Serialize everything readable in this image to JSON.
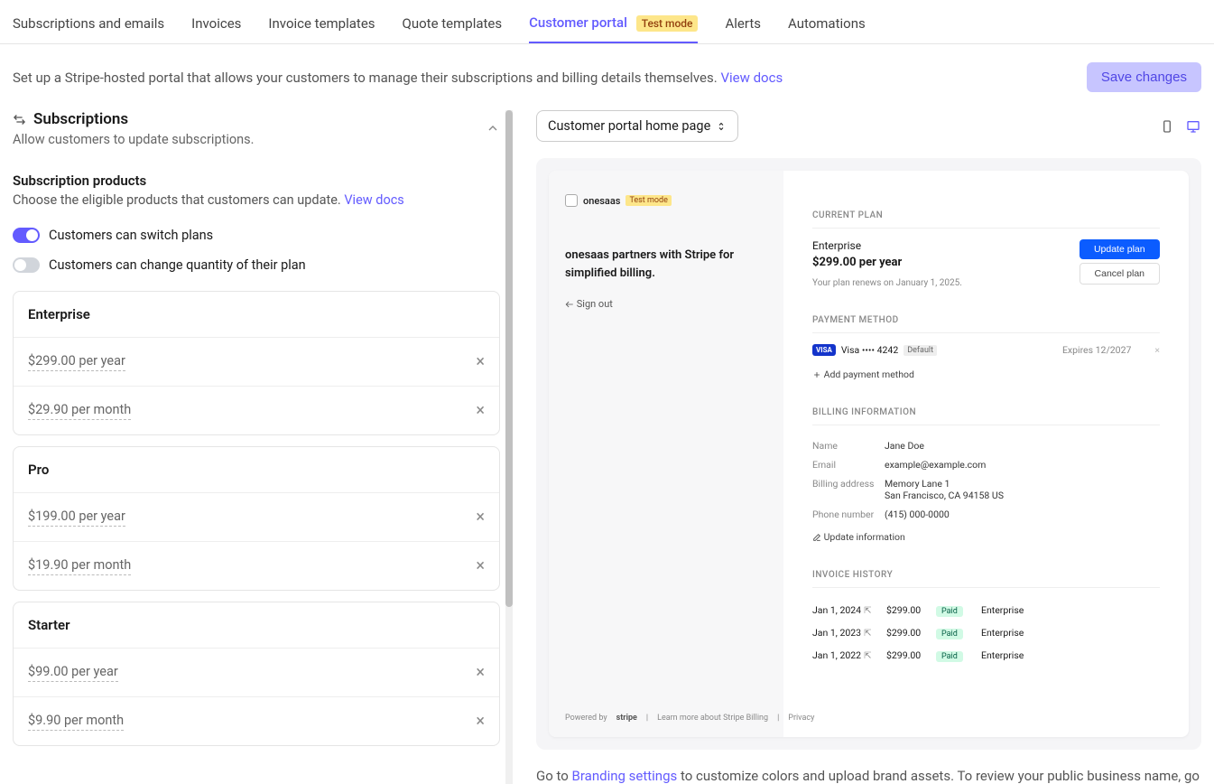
{
  "tabs": {
    "t0": "Subscriptions and emails",
    "t1": "Invoices",
    "t2": "Invoice templates",
    "t3": "Quote templates",
    "t4": "Customer portal",
    "badge": "Test mode",
    "t5": "Alerts",
    "t6": "Automations"
  },
  "desc": {
    "text": "Set up a Stripe-hosted portal that allows your customers to manage their subscriptions and billing details themselves.",
    "link": "View docs"
  },
  "save_btn": "Save changes",
  "section": {
    "title": "Subscriptions",
    "sub": "Allow customers to update subscriptions."
  },
  "subp": {
    "title": "Subscription products",
    "desc": "Choose the eligible products that customers can update.",
    "link": "View docs"
  },
  "toggles": {
    "switch": "Customers can switch plans",
    "qty": "Customers can change quantity of their plan"
  },
  "products": [
    {
      "name": "Enterprise",
      "prices": [
        "$299.00 per year",
        "$29.90 per month"
      ]
    },
    {
      "name": "Pro",
      "prices": [
        "$199.00 per year",
        "$19.90 per month"
      ]
    },
    {
      "name": "Starter",
      "prices": [
        "$99.00 per year",
        "$9.90 per month"
      ]
    }
  ],
  "preview": {
    "selector": "Customer portal home page"
  },
  "portal": {
    "logo": "onesaas",
    "tm": "Test mode",
    "tagline": "onesaas partners with Stripe for simplified billing.",
    "signout": "Sign out",
    "powered": "Powered by",
    "stripe": "stripe",
    "learn": "Learn more about Stripe Billing",
    "priv": "Privacy",
    "s_current": "CURRENT PLAN",
    "plan_name": "Enterprise",
    "plan_price": "$299.00 per year",
    "renew": "Your plan renews on January 1, 2025.",
    "btn_update": "Update plan",
    "btn_cancel": "Cancel plan",
    "s_pm": "PAYMENT METHOD",
    "card": "Visa •••• 4242",
    "def": "Default",
    "exp": "Expires 12/2027",
    "add_pm": "Add payment method",
    "s_bi": "BILLING INFORMATION",
    "bi": {
      "name_k": "Name",
      "name_v": "Jane Doe",
      "email_k": "Email",
      "email_v": "example@example.com",
      "addr_k": "Billing address",
      "addr_v1": "Memory Lane 1",
      "addr_v2": "San Francisco, CA 94158 US",
      "phone_k": "Phone number",
      "phone_v": "(415) 000-0000"
    },
    "upd_info": "Update information",
    "s_inv": "INVOICE HISTORY",
    "inv": [
      {
        "d": "Jan 1, 2024",
        "a": "$299.00",
        "s": "Paid",
        "p": "Enterprise"
      },
      {
        "d": "Jan 1, 2023",
        "a": "$299.00",
        "s": "Paid",
        "p": "Enterprise"
      },
      {
        "d": "Jan 1, 2022",
        "a": "$299.00",
        "s": "Paid",
        "p": "Enterprise"
      }
    ]
  },
  "footer": {
    "pre": "Go to ",
    "link": "Branding settings",
    "post": " to customize colors and upload brand assets. To review your public business name, go"
  }
}
